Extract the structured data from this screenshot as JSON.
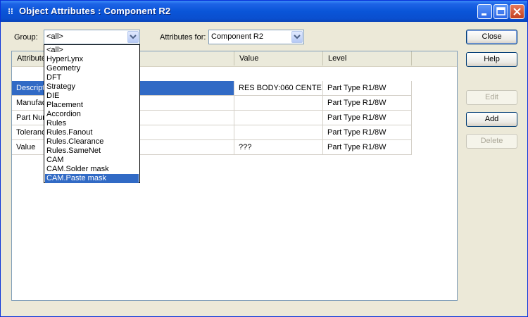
{
  "window": {
    "title": "Object Attributes : Component R2",
    "icon": "attributes-app-icon"
  },
  "controls": {
    "group_label": "Group:",
    "group_value": "<all>",
    "attrs_for_label": "Attributes for:",
    "attrs_for_value": "Component R2"
  },
  "buttons": {
    "close": "Close",
    "help": "Help",
    "edit": "Edit",
    "add": "Add",
    "delete": "Delete"
  },
  "table": {
    "columns": [
      "Attribute",
      "Value",
      "Level"
    ],
    "rows": [
      {
        "name": "Description",
        "value": "RES BODY:060 CENTE",
        "level": "Part Type R1/8W",
        "selected": true
      },
      {
        "name": "Manufacturer",
        "value": "",
        "level": "Part Type R1/8W",
        "selected": false
      },
      {
        "name": "Part Number",
        "value": "",
        "level": "Part Type R1/8W",
        "selected": false
      },
      {
        "name": "Tolerance",
        "value": "",
        "level": "Part Type R1/8W",
        "selected": false
      },
      {
        "name": "Value",
        "value": "???",
        "level": "Part Type R1/8W",
        "selected": false
      }
    ]
  },
  "dropdown": {
    "options": [
      "<all>",
      "HyperLynx",
      "Geometry",
      "DFT",
      "Strategy",
      "DIE",
      "Placement",
      "Accordion",
      "Rules",
      "Rules.Fanout",
      "Rules.Clearance",
      "Rules.SameNet",
      "CAM",
      "CAM.Solder mask",
      "CAM.Paste mask"
    ],
    "highlighted_index": 14
  },
  "colors": {
    "titlebar": "#0a55d8",
    "selection": "#316ac5",
    "dialog_bg": "#ece9d8"
  }
}
